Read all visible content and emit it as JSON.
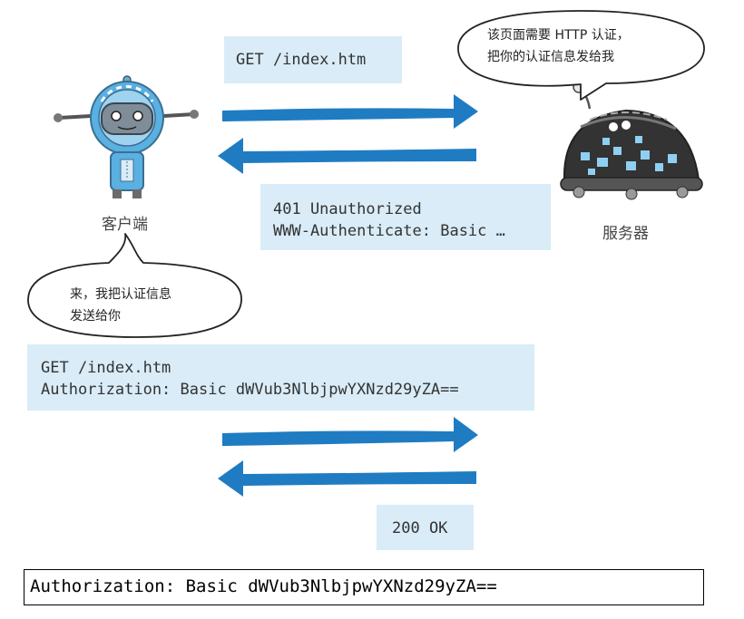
{
  "request1": {
    "line1": "GET /index.htm"
  },
  "response1": {
    "line1": "401 Unauthorized",
    "line2": "WWW-Authenticate: Basic …"
  },
  "request2": {
    "line1": "GET /index.htm",
    "line2": "Authorization: Basic dWVub3NlbjpwYXNzd29yZA=="
  },
  "response2": {
    "line1": "200 OK"
  },
  "client": {
    "label": "客户端",
    "speech_line1": "来，我把认证信息",
    "speech_line2": "发送给你"
  },
  "server": {
    "label": "服务器",
    "speech_line1": "该页面需要 HTTP 认证，",
    "speech_line2": "把你的认证信息发给我"
  },
  "caption": {
    "text": "Authorization: Basic dWVub3NlbjpwYXNzd29yZA=="
  },
  "colors": {
    "arrow": "#1f7cc2",
    "box": "#d9ecf8",
    "robot_body": "#5ab0e0",
    "server_body": "#333333"
  }
}
